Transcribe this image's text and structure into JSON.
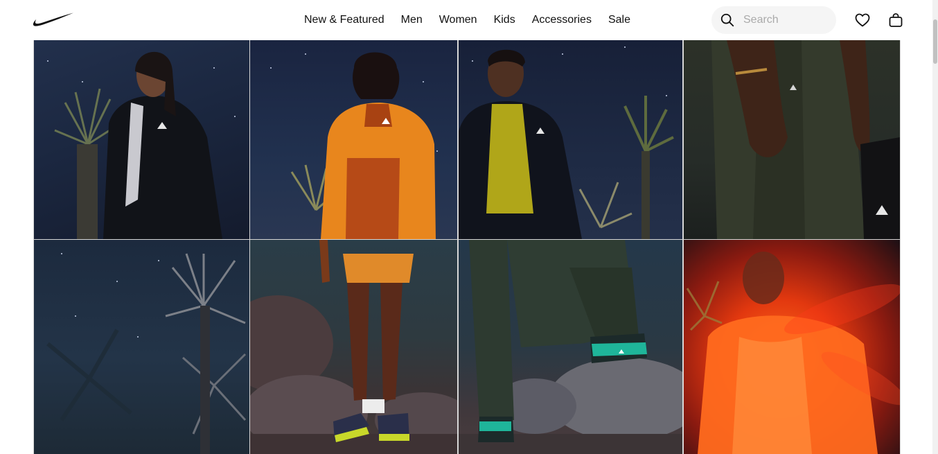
{
  "header": {
    "logo_icon": "nike-swoosh-icon",
    "nav": [
      {
        "label": "New & Featured"
      },
      {
        "label": "Men"
      },
      {
        "label": "Women"
      },
      {
        "label": "Kids"
      },
      {
        "label": "Accessories"
      },
      {
        "label": "Sale"
      }
    ],
    "search": {
      "placeholder": "Search",
      "value": "",
      "icon": "search-icon"
    },
    "favorites_icon": "heart-icon",
    "bag_icon": "shopping-bag-icon"
  },
  "gallery": {
    "tiles": [
      {
        "subject": "woman in black hooded jacket, night desert"
      },
      {
        "subject": "woman in orange jacket, upper body"
      },
      {
        "subject": "man in black jacket with yellow shirt, upper body"
      },
      {
        "subject": "close-up of hands and green trousers"
      },
      {
        "subject": "joshua tree under starry sky"
      },
      {
        "subject": "woman in orange shorts and trail shoes on rocks"
      },
      {
        "subject": "man in green trousers with foot on rock"
      },
      {
        "subject": "motion-blurred figure in orange jacket"
      }
    ]
  },
  "colors": {
    "text": "#111111",
    "search_bg": "#f5f5f5",
    "orange_accent": "#e8861d",
    "night_sky": "#1e2a44"
  }
}
